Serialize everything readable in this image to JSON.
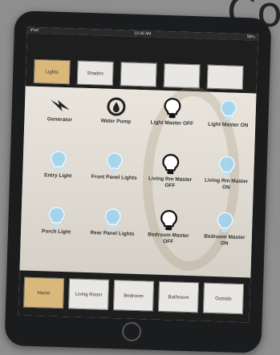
{
  "corner_text": "Co",
  "status": {
    "left": "iPad",
    "time": "10:36 AM",
    "battery": "98%"
  },
  "top_tabs": [
    {
      "label": "Lights",
      "active": true
    },
    {
      "label": "Shades",
      "active": false
    },
    {
      "label": "",
      "active": false
    },
    {
      "label": "",
      "active": false
    },
    {
      "label": "",
      "active": false
    }
  ],
  "tiles": [
    {
      "label": "Generator",
      "icon": "generator-bolt-icon",
      "glow": false
    },
    {
      "label": "Water Pump",
      "icon": "water-pump-icon",
      "glow": false
    },
    {
      "label": "Light Master OFF",
      "icon": "bulb-off-icon",
      "glow": false
    },
    {
      "label": "Light Master ON",
      "icon": "bulb-on-icon",
      "glow": true
    },
    {
      "label": "Entry Light",
      "icon": "bulb-on-icon",
      "glow": true
    },
    {
      "label": "Front Panel Lights",
      "icon": "bulb-on-icon",
      "glow": true
    },
    {
      "label": "Living Rm Master OFF",
      "icon": "bulb-off-icon",
      "glow": false
    },
    {
      "label": "Living Rm Master ON",
      "icon": "bulb-on-icon",
      "glow": true
    },
    {
      "label": "Porch Light",
      "icon": "bulb-on-icon",
      "glow": true
    },
    {
      "label": "Rear Panel Lights",
      "icon": "bulb-on-icon",
      "glow": true
    },
    {
      "label": "Bedroom Master OFF",
      "icon": "bulb-off-icon",
      "glow": false
    },
    {
      "label": "Bedroom Master ON",
      "icon": "bulb-on-icon",
      "glow": true
    }
  ],
  "bottom_tabs": [
    {
      "label": "Home",
      "active": true
    },
    {
      "label": "Living Room",
      "active": false
    },
    {
      "label": "Bedroom",
      "active": false
    },
    {
      "label": "Bathroom",
      "active": false
    },
    {
      "label": "Outside",
      "active": false
    }
  ],
  "colors": {
    "accent": "#d9b87a",
    "glow": "#9fd3f0",
    "bezel": "#1b1c1e"
  }
}
